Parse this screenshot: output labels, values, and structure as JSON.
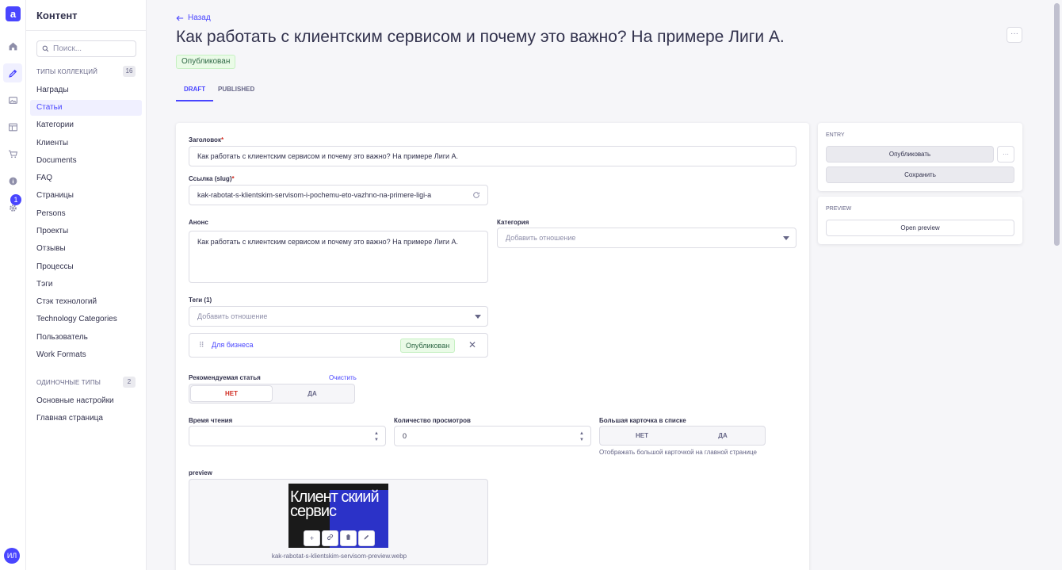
{
  "rail": {
    "logo": "a",
    "notification_count": "1",
    "avatar_initials": "ИЛ"
  },
  "subnav": {
    "title": "Контент",
    "search_placeholder": "Поиск...",
    "collection_types": {
      "label": "Типы коллекций",
      "count": "16",
      "items": [
        "Награды",
        "Статьи",
        "Категории",
        "Клиенты",
        "Documents",
        "FAQ",
        "Страницы",
        "Persons",
        "Проекты",
        "Отзывы",
        "Процессы",
        "Тэги",
        "Стэк технологий",
        "Technology Categories",
        "Пользователь",
        "Work Formats"
      ]
    },
    "single_types": {
      "label": "Одиночные типы",
      "count": "2",
      "items": [
        "Основные настройки",
        "Главная страница"
      ]
    }
  },
  "header": {
    "back_label": "Назад",
    "title": "Как работать с клиентским сервисом и почему это важно? На примере Лиги А.",
    "status": "Опубликован",
    "more_label": "···"
  },
  "tabs": [
    "DRAFT",
    "PUBLISHED"
  ],
  "form": {
    "title_label": "Заголовок",
    "title_value": "Как работать с клиентским сервисом и почему это важно? На примере Лиги А.",
    "slug_label": "Ссылка (slug)",
    "slug_value": "kak-rabotat-s-klientskim-servisom-i-pochemu-eto-vazhno-na-primere-ligi-a",
    "announce_label": "Анонс",
    "announce_value": "Как работать с клиентским сервисом и почему это важно? На примере Лиги А.",
    "category_label": "Категория",
    "category_placeholder": "Добавить отношение",
    "tags_label": "Теги (1)",
    "tags_placeholder": "Добавить отношение",
    "tag_item": {
      "name": "Для бизнеса",
      "status": "Опубликован"
    },
    "recommended_label": "Рекомендуемая статья",
    "clear_label": "Очистить",
    "no_label": "НЕТ",
    "yes_label": "ДА",
    "reading_time_label": "Время чтения",
    "reading_time_value": "",
    "views_label": "Количество просмотров",
    "views_value": "0",
    "big_card_label": "Большая карточка в списке",
    "big_card_hint": "Отображать большой карточкой на главной странице",
    "preview_label": "preview",
    "preview_thumb_text": "Клиент скиий сервис",
    "preview_file": "kak-rabotat-s-klientskim-servisom-preview.webp"
  },
  "entry_panel": {
    "title": "Entry",
    "publish_label": "Опубликовать",
    "more_label": "···",
    "save_label": "Сохранить"
  },
  "preview_panel": {
    "title": "Preview",
    "open_label": "Open preview"
  },
  "colors": {
    "accent": "#4945ff",
    "success_bg": "#eafbe7",
    "success_text": "#2f6846",
    "danger": "#d02b20"
  }
}
